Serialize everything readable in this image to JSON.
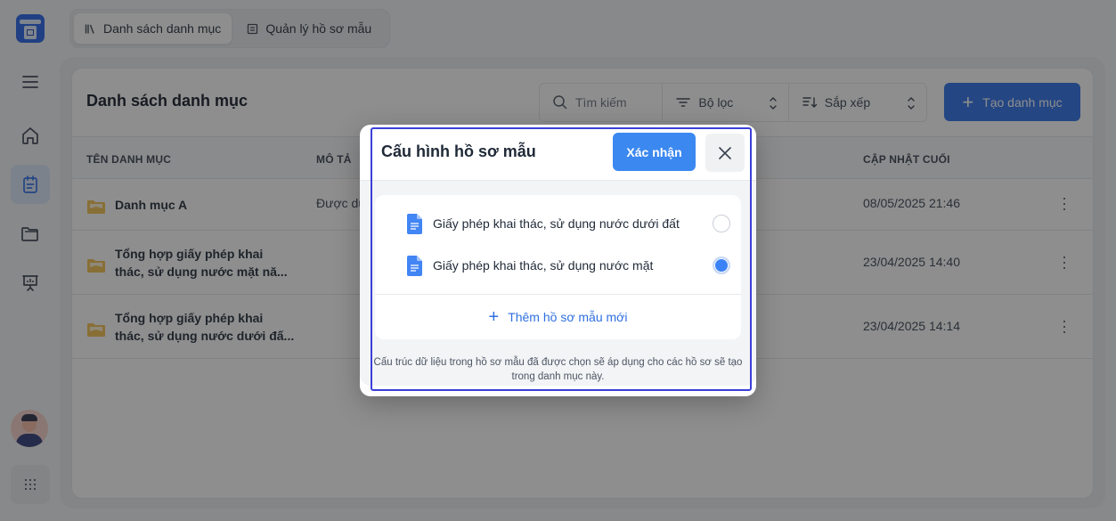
{
  "nav": {
    "tabs": [
      {
        "label": "Danh sách danh mục",
        "active": true
      },
      {
        "label": "Quản lý hồ sơ mẫu",
        "active": false
      }
    ]
  },
  "panel": {
    "title": "Danh sách danh mục",
    "search_placeholder": "Tìm kiếm",
    "filter_label": "Bộ lọc",
    "sort_label": "Sắp xếp",
    "create_label": "Tạo danh mục"
  },
  "table": {
    "headers": [
      "TÊN DANH MỤC",
      "MÔ TẢ",
      "CẬP NHẬT CUỐI"
    ],
    "rows": [
      {
        "name": "Danh mục A",
        "description": "Được dù",
        "updated": "08/05/2025 21:46"
      },
      {
        "name": "Tổng hợp giấy phép khai\nthác, sử dụng nước mặt nă...",
        "description": "",
        "updated": "23/04/2025 14:40"
      },
      {
        "name": "Tổng hợp giấy phép khai\nthác, sử dụng nước dưới đấ...",
        "description": "",
        "updated": "23/04/2025 14:14"
      }
    ]
  },
  "modal": {
    "title": "Cấu hình hồ sơ mẫu",
    "confirm_label": "Xác nhận",
    "templates": [
      {
        "label": "Giấy phép khai thác, sử dụng nước dưới đất",
        "selected": false
      },
      {
        "label": "Giấy phép khai thác, sử dụng nước mặt",
        "selected": true
      }
    ],
    "add_label": "Thêm hồ sơ mẫu mới",
    "note": "Cấu trúc dữ liệu trong hồ sơ mẫu đã được chọn sẽ áp dụng cho các hồ sơ sẽ tạo trong danh mục này."
  },
  "colors": {
    "primary": "#2b6ee8",
    "confirm": "#3b88f0",
    "radio_checked": "#3b82f6",
    "focus_ring": "#3b3fd8",
    "folder": "#f2c14e"
  },
  "icons": [
    "menu-icon",
    "home-icon",
    "calendar-icon",
    "folder-icon",
    "presentation-icon",
    "grid-icon",
    "search-icon",
    "filter-icon",
    "sort-icon",
    "plus-icon",
    "close-icon",
    "document-icon",
    "kebab-icon"
  ]
}
